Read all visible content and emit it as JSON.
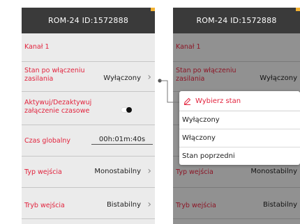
{
  "device_title": "ROM-24 ID:1572888",
  "settings": {
    "channel": "Kanał 1",
    "power_on_state": {
      "label": "Stan po włączeniu zasilania",
      "value": "Wyłączony"
    },
    "timer_toggle": {
      "label": "Aktywuj/Dezaktywuj załączenie czasowe",
      "enabled": true
    },
    "global_time": {
      "label": "Czas globalny",
      "value": "00h:01m:40s"
    },
    "input_type": {
      "label": "Typ wejścia",
      "value": "Monostabilny"
    },
    "input_mode": {
      "label": "Tryb wejścia",
      "value": "Bistabilny"
    }
  },
  "popup": {
    "title": "Wybierz stan",
    "options": [
      "Wyłączony",
      "Włączony",
      "Stan poprzedni"
    ]
  },
  "icons": {
    "chevron": "chevron-right-icon",
    "edit": "pencil-icon"
  },
  "colors": {
    "accent": "#e2233d",
    "header": "#3a3a3a",
    "background": "#ebebeb"
  }
}
